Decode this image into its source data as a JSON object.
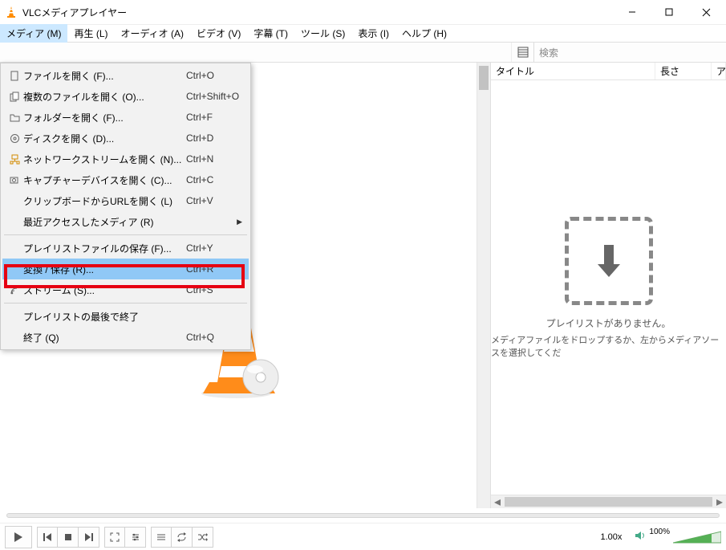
{
  "window": {
    "title": "VLCメディアプレイヤー"
  },
  "menubar": {
    "items": [
      "メディア (M)",
      "再生 (L)",
      "オーディオ (A)",
      "ビデオ (V)",
      "字幕 (T)",
      "ツール (S)",
      "表示 (I)",
      "ヘルプ (H)"
    ]
  },
  "media_menu": {
    "items": [
      {
        "label": "ファイルを開く (F)...",
        "shortcut": "Ctrl+O",
        "icon": "file"
      },
      {
        "label": "複数のファイルを開く (O)...",
        "shortcut": "Ctrl+Shift+O",
        "icon": "files"
      },
      {
        "label": "フォルダーを開く (F)...",
        "shortcut": "Ctrl+F",
        "icon": "folder"
      },
      {
        "label": "ディスクを開く (D)...",
        "shortcut": "Ctrl+D",
        "icon": "disc"
      },
      {
        "label": "ネットワークストリームを開く (N)...",
        "shortcut": "Ctrl+N",
        "icon": "network"
      },
      {
        "label": "キャプチャーデバイスを開く (C)...",
        "shortcut": "Ctrl+C",
        "icon": "capture"
      },
      {
        "label": "クリップボードからURLを開く (L)",
        "shortcut": "Ctrl+V",
        "icon": ""
      },
      {
        "label": "最近アクセスしたメディア (R)",
        "shortcut": "",
        "icon": "",
        "submenu": true
      },
      {
        "sep": true
      },
      {
        "label": "プレイリストファイルの保存 (F)...",
        "shortcut": "Ctrl+Y",
        "icon": ""
      },
      {
        "label": "変換 / 保存 (R)...",
        "shortcut": "Ctrl+R",
        "icon": "",
        "highlight": true
      },
      {
        "label": "ストリーム (S)...",
        "shortcut": "Ctrl+S",
        "icon": "stream"
      },
      {
        "sep": true
      },
      {
        "label": "プレイリストの最後で終了",
        "shortcut": "",
        "icon": ""
      },
      {
        "label": "終了 (Q)",
        "shortcut": "Ctrl+Q",
        "icon": ""
      }
    ]
  },
  "search": {
    "placeholder": "検索"
  },
  "playlist": {
    "columns": {
      "title": "タイトル",
      "length": "長さ",
      "album": "ア"
    },
    "empty_title": "プレイリストがありません。",
    "empty_hint": "メディアファイルをドロップするか、左からメディアソースを選択してくだ"
  },
  "controls": {
    "speed": "1.00x",
    "volume_pct": "100%"
  }
}
